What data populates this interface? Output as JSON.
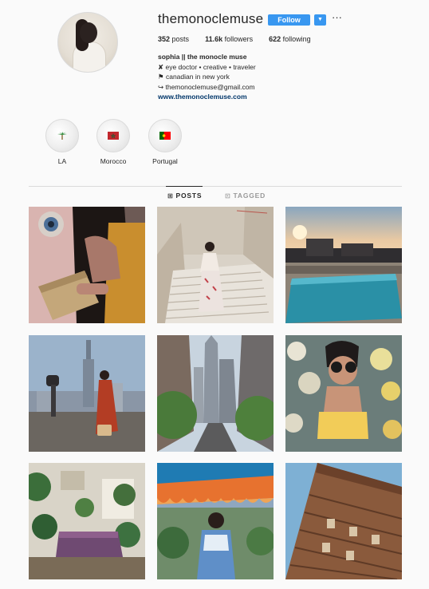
{
  "profile": {
    "username": "themonoclemuse",
    "follow_label": "Follow",
    "dropdown_icon": "chevron-down-icon",
    "more_icon": "ellipsis-icon",
    "stats": {
      "posts_count": "352",
      "posts_label": "posts",
      "followers_count": "11.6k",
      "followers_label": "followers",
      "following_count": "622",
      "following_label": "following"
    },
    "bio": {
      "name": "sophia || the monocle muse",
      "line1": "✘ eye doctor • creative • traveler",
      "line2": "⚑ canadian in new york",
      "line3": "↪ themonoclemuse@gmail.com",
      "website": "www.themonoclemuse.com"
    }
  },
  "highlights": [
    {
      "label": "LA",
      "icon": "palm-tree-icon"
    },
    {
      "label": "Morocco",
      "icon": "morocco-flag-icon"
    },
    {
      "label": "Portugal",
      "icon": "portugal-flag-icon"
    }
  ],
  "tabs": {
    "posts_label": "POSTS",
    "tagged_label": "TAGGED"
  },
  "colors": {
    "accent": "#3897f0",
    "background": "#fafafa",
    "link": "#003569"
  },
  "posts": [
    {
      "subject": "woman-with-straw-clutch"
    },
    {
      "subject": "woman-on-stairs-fidel"
    },
    {
      "subject": "rooftop-pool-sunset"
    },
    {
      "subject": "empire-state-observation-deck"
    },
    {
      "subject": "city-street-skyscrapers"
    },
    {
      "subject": "woman-with-sunglasses-flowers"
    },
    {
      "subject": "plant-shop-interior"
    },
    {
      "subject": "woman-under-orange-umbrella"
    },
    {
      "subject": "ornate-building-facade"
    }
  ]
}
